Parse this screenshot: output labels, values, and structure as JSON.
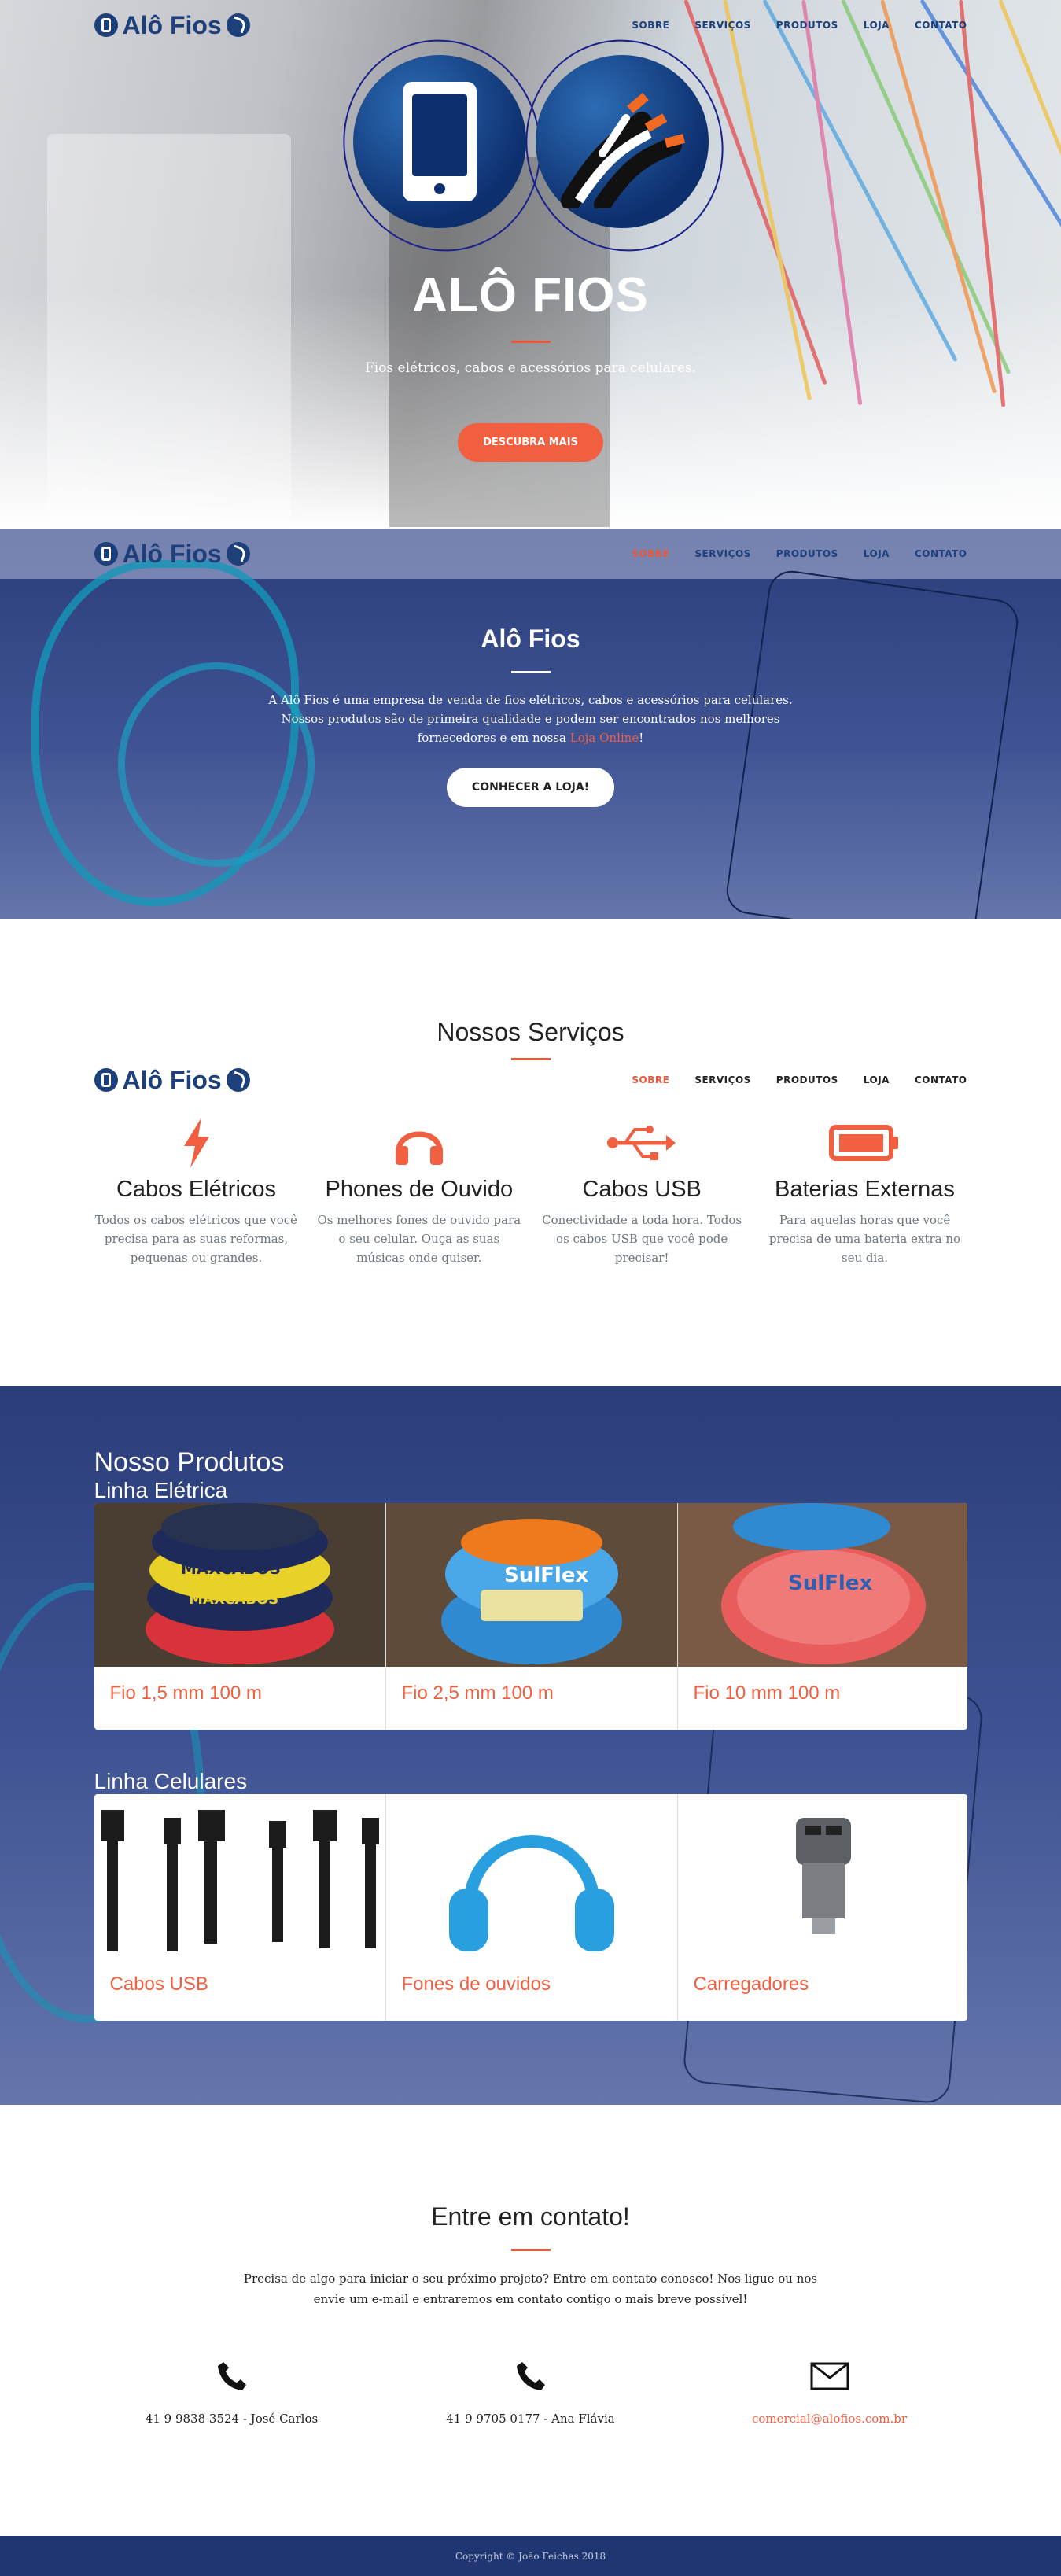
{
  "brand": {
    "logo_text": "Alô Fios"
  },
  "nav": {
    "items": [
      "SOBRE",
      "SERVIÇOS",
      "PRODUTOS",
      "LOJA",
      "CONTATO"
    ]
  },
  "hero": {
    "title": "ALÔ FIOS",
    "subtitle": "Fios elétricos, cabos e acessórios para celulares.",
    "cta": "DESCUBRA MAIS"
  },
  "about": {
    "title": "Alô Fios",
    "text_before_link": "A Alô Fios é uma empresa de venda de fios elétricos, cabos e acessórios para celulares. Nossos produtos são de primeira qualidade e podem ser encontrados nos melhores fornecedores e em nossa ",
    "link_text": "Loja Online",
    "text_after_link": "!",
    "cta": "CONHECER A LOJA!"
  },
  "services": {
    "title": "Nossos Serviços",
    "items": [
      {
        "icon": "bolt-icon",
        "title": "Cabos Elétricos",
        "text": "Todos os cabos elétricos que você precisa para as suas reformas, pequenas ou grandes."
      },
      {
        "icon": "headphones-icon",
        "title": "Phones de Ouvido",
        "text": "Os melhores fones de ouvido para o seu celular. Ouça as suas músicas onde quiser."
      },
      {
        "icon": "usb-icon",
        "title": "Cabos USB",
        "text": "Conectividade a toda hora. Todos os cabos USB que você pode precisar!"
      },
      {
        "icon": "battery-icon",
        "title": "Baterias Externas",
        "text": "Para aquelas horas que você precisa de uma bateria extra no seu dia."
      }
    ]
  },
  "products": {
    "title": "Nosso Produtos",
    "eletrica": {
      "title": "Linha Elétrica",
      "items": [
        "Fio 1,5 mm 100 m",
        "Fio 2,5 mm 100 m",
        "Fio 10 mm 100 m"
      ]
    },
    "celulares": {
      "title": "Linha Celulares",
      "items": [
        "Cabos USB",
        "Fones de ouvidos",
        "Carregadores"
      ]
    }
  },
  "contact": {
    "title": "Entre em contato!",
    "text": "Precisa de algo para iniciar o seu próximo projeto? Entre em contato conosco! Nos ligue ou nos envie um e-mail e entraremos em contato contigo o mais breve possível!",
    "phone1": "41 9 9838 3524 - José Carlos",
    "phone2": "41 9 9705 0177 - Ana Flávia",
    "email": "comercial@alofios.com.br"
  },
  "footer": {
    "copyright": "Copyright © João Feichas 2018"
  },
  "colors": {
    "accent": "#f05f40",
    "brand": "#1d3f7a",
    "footer": "#203672"
  }
}
